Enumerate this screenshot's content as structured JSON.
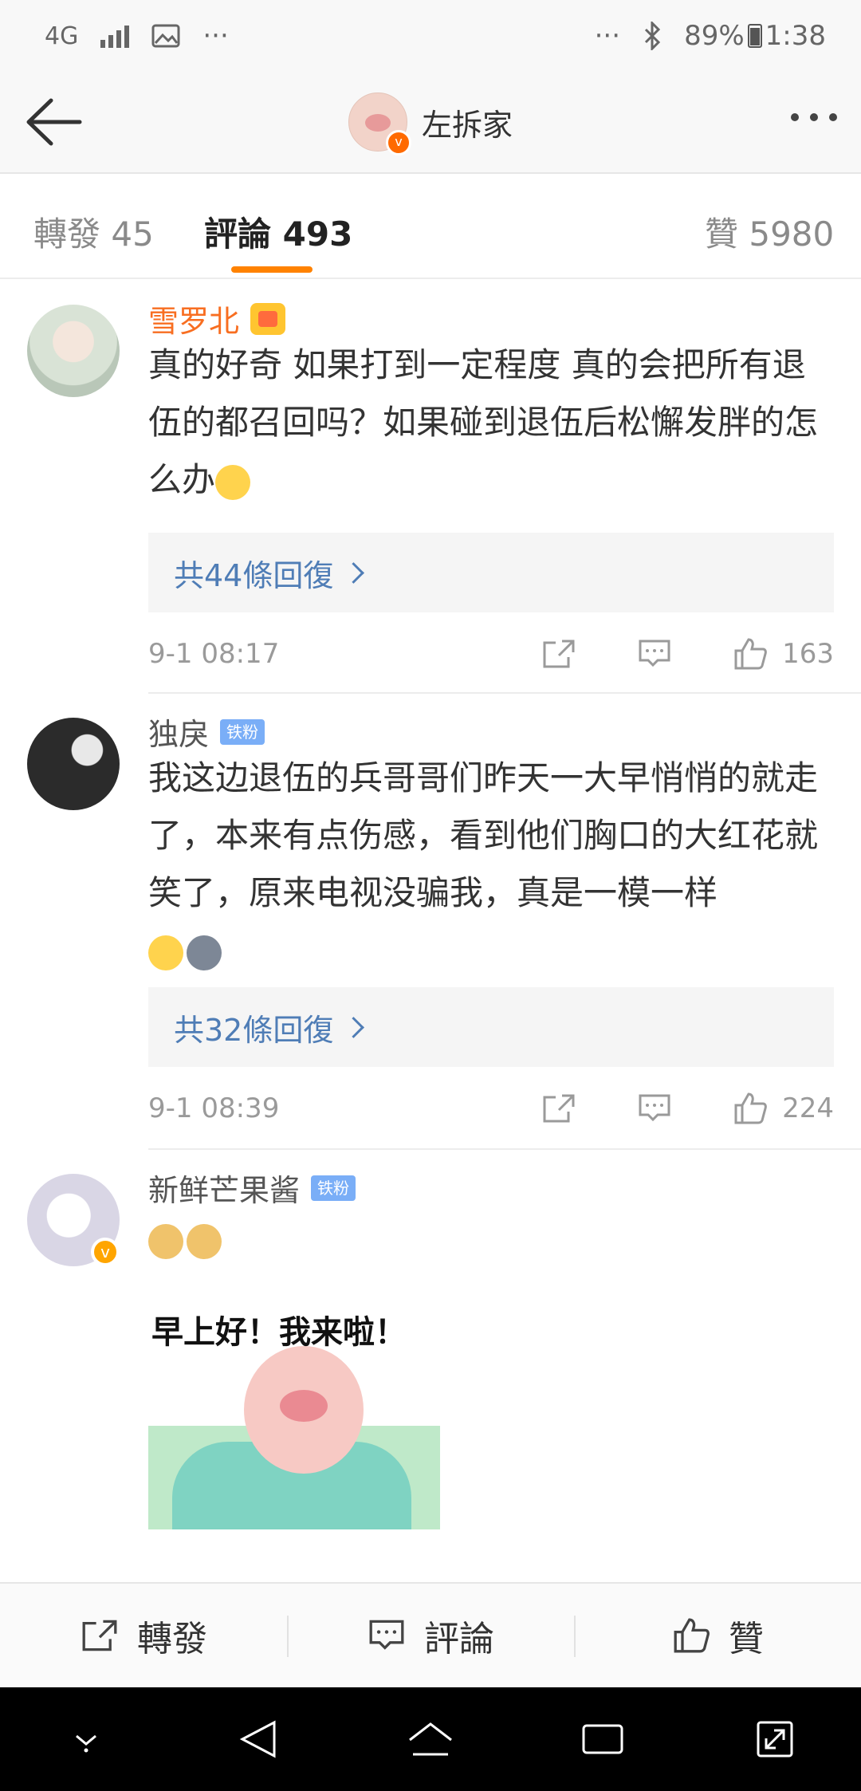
{
  "status_bar": {
    "network": "4G",
    "dots_left": "···",
    "dots_right": "···",
    "battery": "89%",
    "time": "1:38"
  },
  "nav": {
    "title": "左拆家"
  },
  "tabs": [
    {
      "label": "轉發 45"
    },
    {
      "label": "評論 493"
    },
    {
      "label": "贊 5980"
    }
  ],
  "comments": [
    {
      "user": "雪罗北",
      "text": "真的好奇 如果打到一定程度 真的会把所有退伍的都召回吗？如果碰到退伍后松懈发胖的怎么办",
      "replies": "共44條回復",
      "time": "9-1 08:17",
      "likes": "163"
    },
    {
      "user": "独戾",
      "badge": "铁粉",
      "text": "我这边退伍的兵哥哥们昨天一大早悄悄的就走了，本来有点伤感，看到他们胸口的大红花就笑了，原来电视没骗我，真是一模一样",
      "replies": "共32條回復",
      "time": "9-1 08:39",
      "likes": "224"
    },
    {
      "user": "新鲜芒果酱",
      "badge": "铁粉",
      "sticker_caption": "早上好！我来啦！"
    }
  ],
  "action_bar": {
    "repost": "轉發",
    "comment": "評論",
    "like": "贊"
  }
}
